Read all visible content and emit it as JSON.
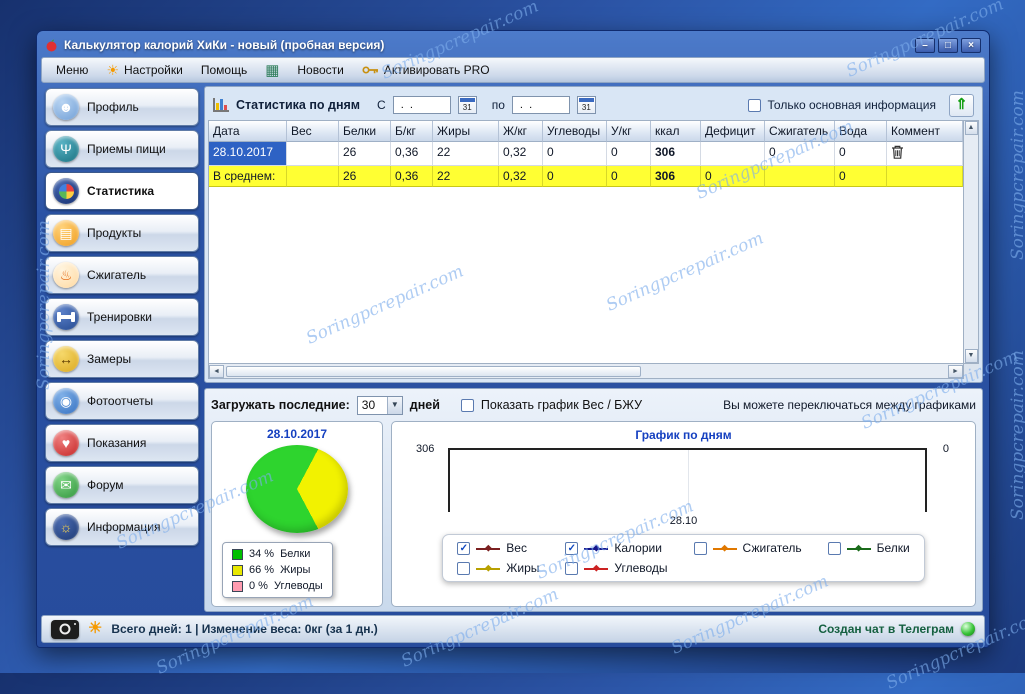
{
  "watermark": "Soringpcrepair.com",
  "window": {
    "title": "Калькулятор калорий ХиКи - новый (пробная версия)",
    "minimize": "–",
    "maximize": "□",
    "close": "×"
  },
  "menubar": {
    "menu": "Меню",
    "settings": "Настройки",
    "help": "Помощь",
    "news": "Новости",
    "activate": "Активировать PRO"
  },
  "icons": {
    "sun": "☀",
    "calculator": "▦",
    "dropdown_arrow": "▼",
    "export_up": "⇑",
    "check": "✓",
    "scroll_up": "▲",
    "scroll_down": "▼",
    "scroll_left": "◄",
    "scroll_right": "►",
    "person": "☻",
    "cutlery": "Ψ",
    "bag": "▤",
    "flame": "♨",
    "measure": "↔",
    "lens": "◉",
    "heart": "♥",
    "mail": "✉",
    "bulb": "☼"
  },
  "sidebar": {
    "items": [
      {
        "label": "Профиль"
      },
      {
        "label": "Приемы пищи"
      },
      {
        "label": "Статистика",
        "selected": true
      },
      {
        "label": "Продукты"
      },
      {
        "label": "Сжигатель"
      },
      {
        "label": "Тренировки"
      },
      {
        "label": "Замеры"
      },
      {
        "label": "Фотоотчеты"
      },
      {
        "label": "Показания"
      },
      {
        "label": "Форум"
      },
      {
        "label": "Информация"
      }
    ]
  },
  "stats": {
    "title": "Статистика по дням",
    "from_label": "С",
    "to_label": "по",
    "date_from": " .  . ",
    "date_to": " .  . ",
    "calendar": "31",
    "only_main_label": "Только основная информация",
    "columns": [
      "Дата",
      "Вес",
      "Белки",
      "Б/кг",
      "Жиры",
      "Ж/кг",
      "Углеводы",
      "У/кг",
      "ккал",
      "Дефицит",
      "Сжигатель",
      "Вода",
      "Коммент"
    ],
    "row": [
      "28.10.2017",
      "",
      "26",
      "0,36",
      "22",
      "0,32",
      "0",
      "0",
      "306",
      "",
      "0",
      "0",
      ""
    ],
    "avg": [
      "В среднем:",
      "",
      "26",
      "0,36",
      "22",
      "0,32",
      "0",
      "0",
      "306",
      "0",
      "",
      "0",
      ""
    ]
  },
  "charts": {
    "load_label": "Загружать последние:",
    "days_value": "30",
    "days_label": "дней",
    "show_bju_label": "Показать график Вес / БЖУ",
    "hint": "Вы можете переключаться между графиками",
    "pie_date": "28.10.2017",
    "pie_legend": [
      {
        "pct": "34 %",
        "name": "Белки"
      },
      {
        "pct": "66 %",
        "name": "Жиры"
      },
      {
        "pct": "0 %",
        "name": "Углеводы"
      }
    ],
    "line_title": "График по дням",
    "y_left": "306",
    "y_right": "0",
    "x_tick": "28.10",
    "toggles": [
      {
        "label": "Вес",
        "checked": true
      },
      {
        "label": "Калории",
        "checked": true
      },
      {
        "label": "Сжигатель",
        "checked": false
      },
      {
        "label": "Белки",
        "checked": false
      },
      {
        "label": "Жиры",
        "checked": false
      },
      {
        "label": "Углеводы",
        "checked": false
      }
    ]
  },
  "statusbar": {
    "summary": "Всего дней: 1 | Изменение веса: 0кг (за 1 дн.)",
    "telegram": "Создан чат в Телеграм"
  },
  "colors": {
    "selected_cell": "#2e62c4",
    "avg_row": "#ffff33",
    "pie_green": "#2ed42e",
    "pie_yellow": "#f2f200",
    "legend_belki": "#00c000",
    "legend_zhiry": "#e8e800",
    "legend_uglevody": "#ff9cb0",
    "series_ves": "#7b2020",
    "series_kalorii": "#16168c",
    "series_szhigatel": "#e07800",
    "series_belki": "#1a6b1a",
    "series_zhiry": "#b8a000",
    "series_uglevody": "#cc2222"
  },
  "chart_data": [
    {
      "type": "pie",
      "title": "28.10.2017",
      "labels": [
        "Белки",
        "Жиры",
        "Углеводы"
      ],
      "values": [
        34,
        66,
        0
      ],
      "unit": "%",
      "colors": [
        "#00c000",
        "#e8e800",
        "#ff9cb0"
      ]
    },
    {
      "type": "line",
      "title": "График по дням",
      "x": [
        "28.10"
      ],
      "series": [
        {
          "name": "Калории",
          "values": [
            306
          ]
        },
        {
          "name": "Вес",
          "values": [
            0
          ]
        }
      ],
      "ylim_left": [
        0,
        306
      ],
      "ylim_right": [
        0,
        0
      ],
      "legend_position": "bottom"
    }
  ]
}
